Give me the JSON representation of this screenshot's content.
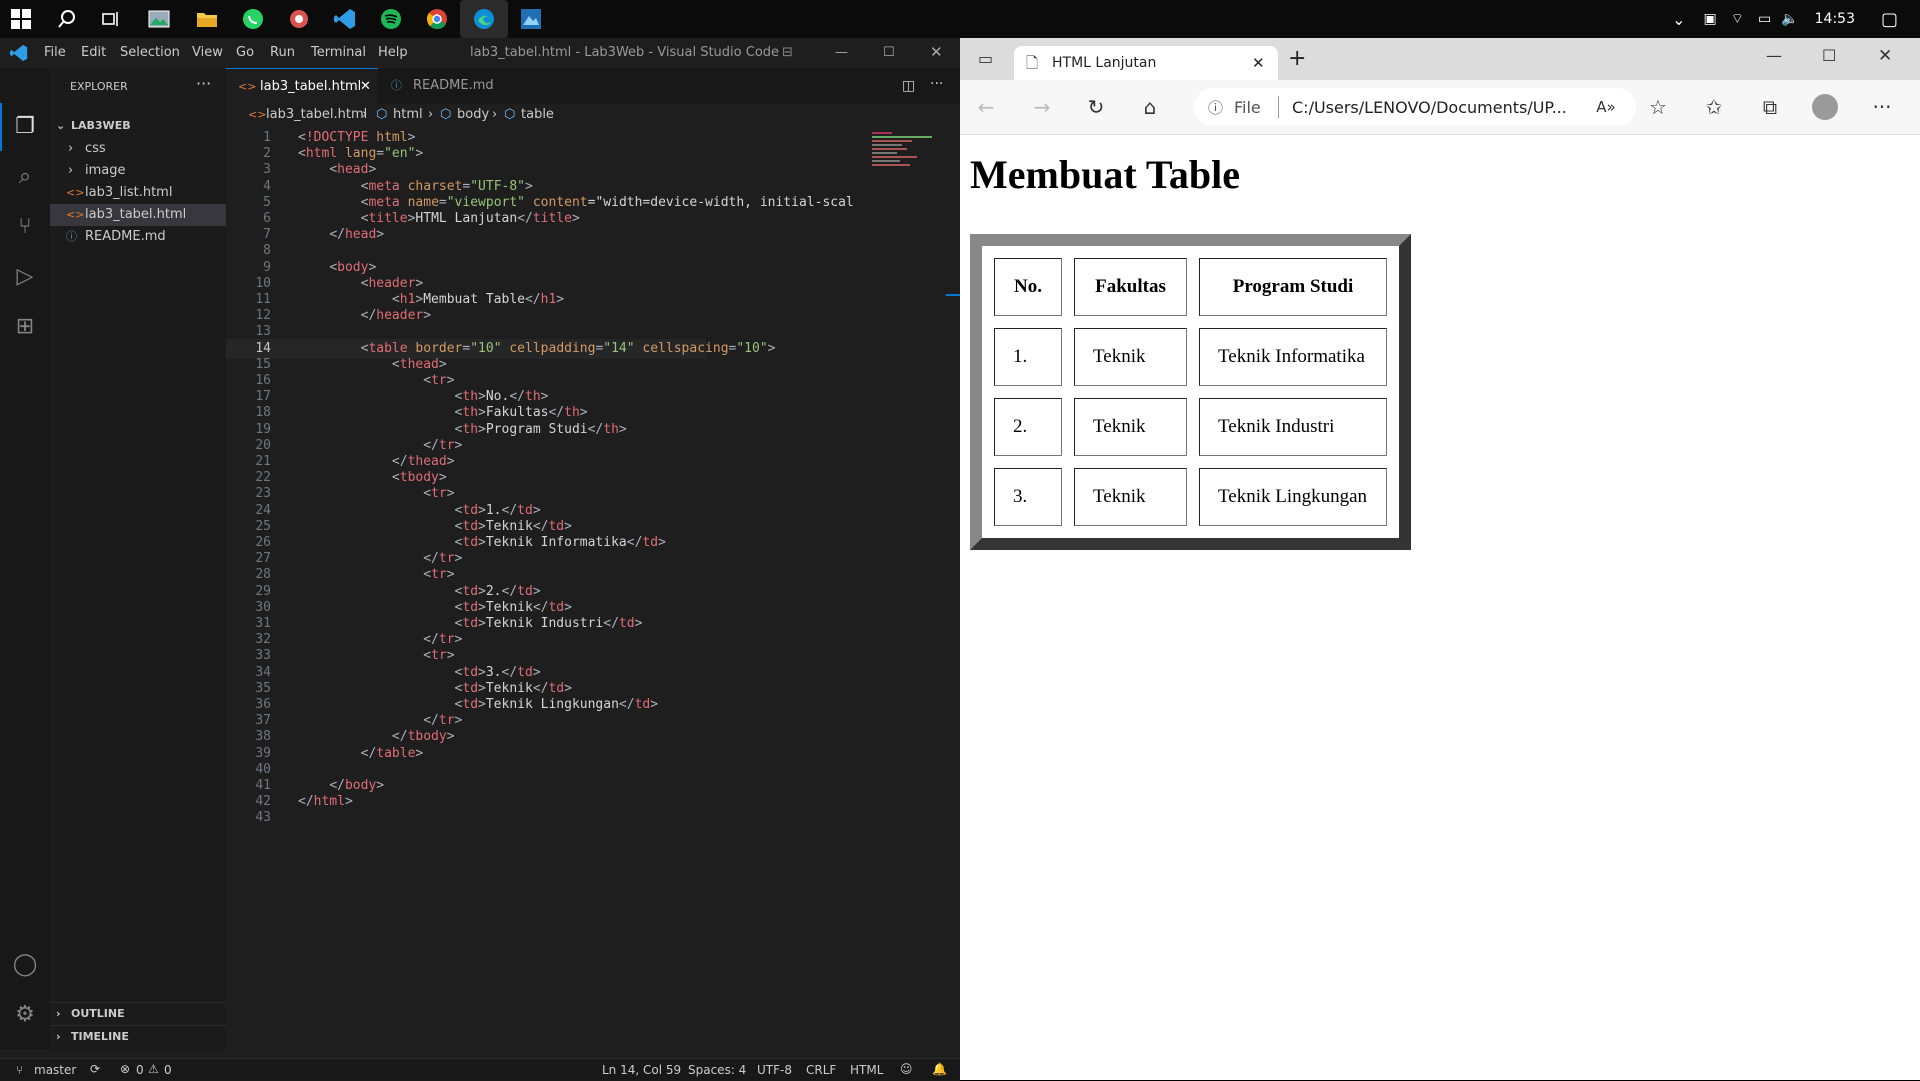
{
  "taskbar": {
    "icons": [
      "windows-icon",
      "search-icon",
      "task-view-icon",
      "photos-icon",
      "file-explorer-icon",
      "whatsapp-icon",
      "app-icon",
      "vscode-icon",
      "spotify-icon",
      "chrome-icon",
      "edge-icon",
      "app2-icon"
    ],
    "time": "14:53"
  },
  "vscode": {
    "menu": [
      "File",
      "Edit",
      "Selection",
      "View",
      "Go",
      "Run",
      "Terminal",
      "Help"
    ],
    "window_title": "lab3_tabel.html - Lab3Web - Visual Studio Code",
    "explorer_label": "EXPLORER",
    "project": "LAB3WEB",
    "tree": [
      {
        "label": "css",
        "type": "folder"
      },
      {
        "label": "image",
        "type": "folder"
      },
      {
        "label": "lab3_list.html",
        "type": "html"
      },
      {
        "label": "lab3_tabel.html",
        "type": "html",
        "selected": true
      },
      {
        "label": "README.md",
        "type": "md"
      }
    ],
    "outline_label": "OUTLINE",
    "timeline_label": "TIMELINE",
    "tabs": [
      {
        "label": "lab3_tabel.html",
        "active": true
      },
      {
        "label": "README.md",
        "active": false
      }
    ],
    "breadcrumb": [
      "lab3_tabel.html",
      "html",
      "body",
      "table"
    ],
    "current_line": 14,
    "status": {
      "branch": "master",
      "problems": "0",
      "warnings": "0",
      "position": "Ln 14, Col 59",
      "spaces": "Spaces: 4",
      "encoding": "UTF-8",
      "eol": "CRLF",
      "language": "HTML"
    }
  },
  "browser": {
    "tab_title": "HTML Lanjutan",
    "address_prefix": "File",
    "address": "C:/Users/LENOVO/Documents/UP...",
    "page": {
      "heading": "Membuat Table",
      "headers": [
        "No.",
        "Fakultas",
        "Program Studi"
      ],
      "rows": [
        [
          "1.",
          "Teknik",
          "Teknik Informatika"
        ],
        [
          "2.",
          "Teknik",
          "Teknik Industri"
        ],
        [
          "3.",
          "Teknik",
          "Teknik Lingkungan"
        ]
      ]
    }
  },
  "code_lines": [
    "<!DOCTYPE html>",
    "<html lang=\"en\">",
    "    <head>",
    "        <meta charset=\"UTF-8\">",
    "        <meta name=\"viewport\" content=\"width=device-width, initial-scal",
    "        <title>HTML Lanjutan</title>",
    "    </head>",
    "",
    "    <body>",
    "        <header>",
    "            <h1>Membuat Table</h1>",
    "        </header>",
    "",
    "        <table border=\"10\" cellpadding=\"14\" cellspacing=\"10\">",
    "            <thead>",
    "                <tr>",
    "                    <th>No.</th>",
    "                    <th>Fakultas</th>",
    "                    <th>Program Studi</th>",
    "                </tr>",
    "            </thead>",
    "            <tbody>",
    "                <tr>",
    "                    <td>1.</td>",
    "                    <td>Teknik</td>",
    "                    <td>Teknik Informatika</td>",
    "                </tr>",
    "                <tr>",
    "                    <td>2.</td>",
    "                    <td>Teknik</td>",
    "                    <td>Teknik Industri</td>",
    "                </tr>",
    "                <tr>",
    "                    <td>3.</td>",
    "                    <td>Teknik</td>",
    "                    <td>Teknik Lingkungan</td>",
    "                </tr>",
    "            </tbody>",
    "        </table>",
    "",
    "    </body>",
    "</html>",
    ""
  ]
}
